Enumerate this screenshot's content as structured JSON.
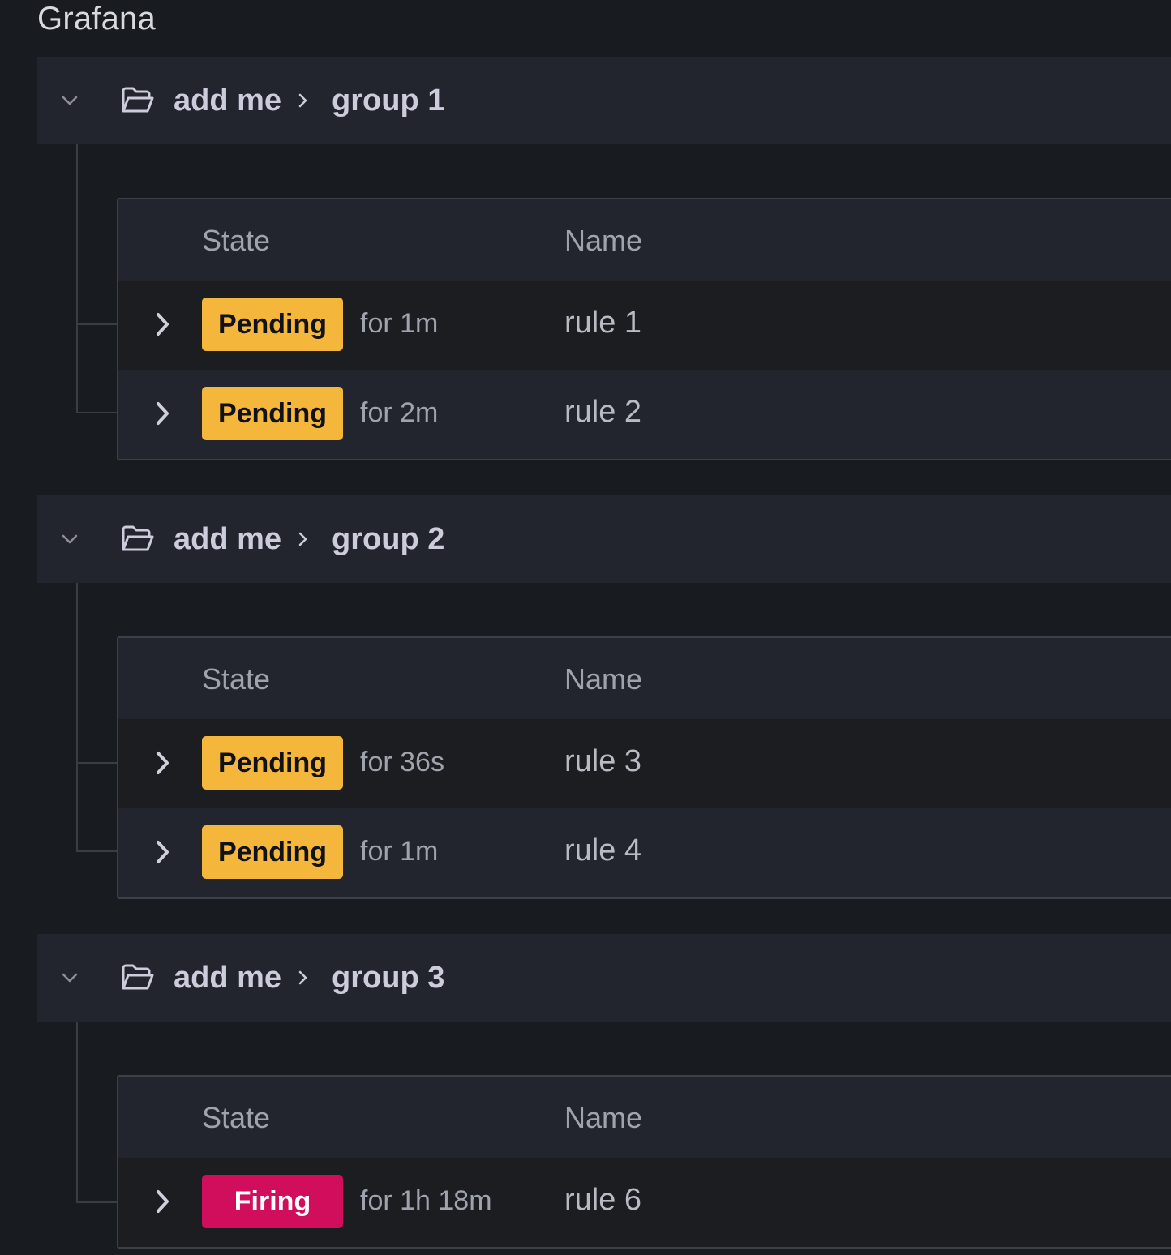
{
  "page": {
    "title": "Grafana"
  },
  "table_headers": {
    "state": "State",
    "name": "Name"
  },
  "colors": {
    "pending": "#f5b73b",
    "firing": "#d10e5c",
    "background": "#181b1f",
    "panel": "#22252d"
  },
  "groups": [
    {
      "folder": "add me",
      "name": "group 1",
      "expanded": true,
      "rules": [
        {
          "state": "Pending",
          "duration": "for 1m",
          "name": "rule 1"
        },
        {
          "state": "Pending",
          "duration": "for 2m",
          "name": "rule 2"
        }
      ]
    },
    {
      "folder": "add me",
      "name": "group 2",
      "expanded": true,
      "rules": [
        {
          "state": "Pending",
          "duration": "for 36s",
          "name": "rule 3"
        },
        {
          "state": "Pending",
          "duration": "for 1m",
          "name": "rule 4"
        }
      ]
    },
    {
      "folder": "add me",
      "name": "group 3",
      "expanded": true,
      "rules": [
        {
          "state": "Firing",
          "duration": "for 1h 18m",
          "name": "rule 6"
        }
      ]
    }
  ]
}
